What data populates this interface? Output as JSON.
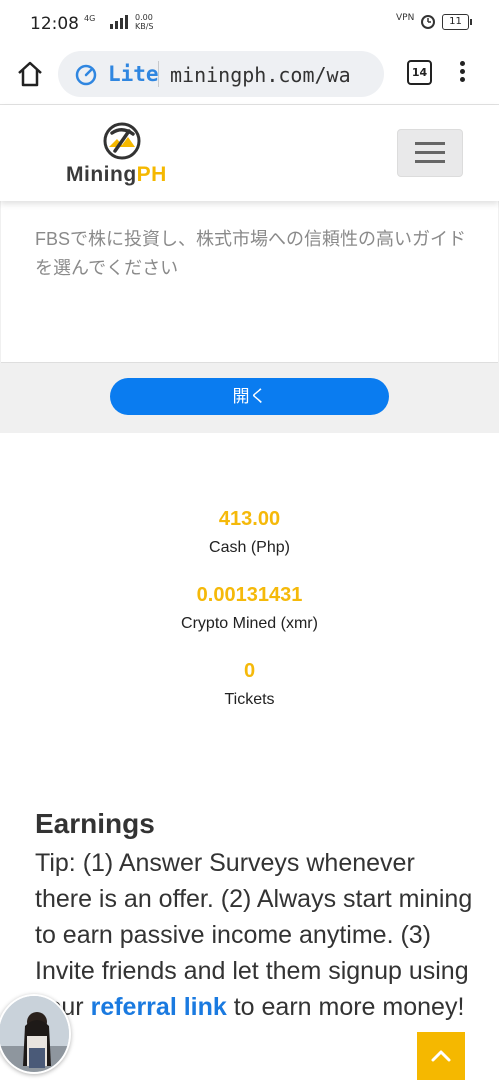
{
  "status_bar": {
    "time": "12:08",
    "network": "4G",
    "speed_value": "0.00",
    "speed_unit": "KB/S",
    "vpn_label": "VPN",
    "battery": "11"
  },
  "browser": {
    "lite_label": "Lite",
    "url": "miningph.com/wa",
    "tab_count": "14"
  },
  "site": {
    "logo_text_main": "Mining",
    "logo_text_accent": "PH"
  },
  "ad": {
    "text": "FBSで株に投資し、株式市場への信頼性の高いガイドを選んでください",
    "button_label": "開く"
  },
  "stats": [
    {
      "value": "413.00",
      "label": "Cash (Php)"
    },
    {
      "value": "0.00131431",
      "label": "Crypto Mined (xmr)"
    },
    {
      "value": "0",
      "label": "Tickets"
    }
  ],
  "earnings": {
    "title": "Earnings",
    "tip_prefix": "Tip: (1) Answer Surveys whenever there is an offer. (2) Always start mining to earn passive income anytime. (3) Invite friends and let them signup using your ",
    "referral_link": "referral link",
    "tip_suffix": " to earn more money!"
  },
  "colors": {
    "accent_yellow": "#f5b90a",
    "button_blue": "#0a7cf0",
    "link_blue": "#1a7ae0"
  }
}
